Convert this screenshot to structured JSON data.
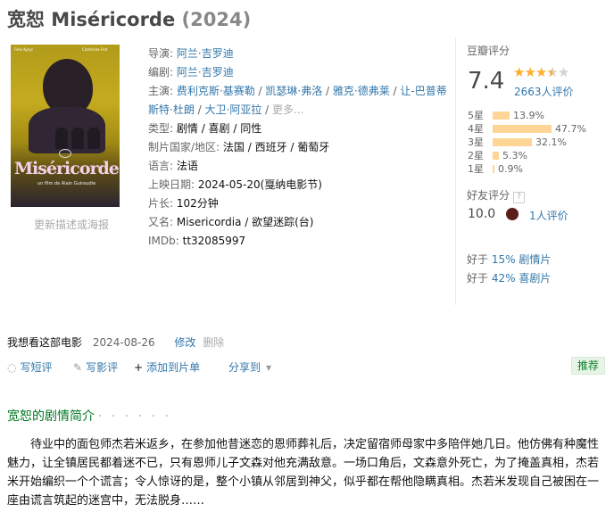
{
  "title": {
    "main": "宽恕 Miséricorde",
    "year": "(2024)"
  },
  "poster": {
    "big_title": "Miséricorde",
    "subtitle": "un film de Alain Guiraudie",
    "actor_left": "Félix Kysyl",
    "actor_right": "Catherine Frot",
    "link_text": "更新描述或海报"
  },
  "info": {
    "director_label": "导演:",
    "director": "阿兰·吉罗迪",
    "writer_label": "编剧:",
    "writer": "阿兰·吉罗迪",
    "cast_label": "主演:",
    "cast": [
      "费利克斯·基赛勒",
      "凯瑟琳·弗洛",
      "雅克·德弗莱",
      "让-巴普蒂斯特·杜朗",
      "大卫·阿亚拉"
    ],
    "cast_more": "更多...",
    "genre_label": "类型:",
    "genre": "剧情 / 喜剧 / 同性",
    "country_label": "制片国家/地区:",
    "country": "法国 / 西班牙 / 葡萄牙",
    "language_label": "语言:",
    "language": "法语",
    "release_label": "上映日期:",
    "release": "2024-05-20(戛纳电影节)",
    "runtime_label": "片长:",
    "runtime": "102分钟",
    "aka_label": "又名:",
    "aka": "Misericordia / 欲望迷踪(台)",
    "imdb_label": "IMDb:",
    "imdb": "tt32085997"
  },
  "rating": {
    "label": "豆瓣评分",
    "score": "7.4",
    "stars": 3.5,
    "votes": "2663人评价",
    "distribution": [
      {
        "label": "5星",
        "pct": "13.9%",
        "value": 13.9
      },
      {
        "label": "4星",
        "pct": "47.7%",
        "value": 47.7
      },
      {
        "label": "3星",
        "pct": "32.1%",
        "value": 32.1
      },
      {
        "label": "2星",
        "pct": "5.3%",
        "value": 5.3
      },
      {
        "label": "1星",
        "pct": "0.9%",
        "value": 0.9
      }
    ],
    "friend_label": "好友评分",
    "friend_help": "?",
    "friend_score": "10.0",
    "friend_count": "1人评价",
    "better": [
      {
        "prefix": "好于",
        "pct": "15%",
        "genre": "剧情片"
      },
      {
        "prefix": "好于",
        "pct": "42%",
        "genre": "喜剧片"
      }
    ]
  },
  "status": {
    "text": "我想看这部电影",
    "date": "2024-08-26",
    "edit": "修改",
    "delete": "删除"
  },
  "actions": {
    "comment": "写短评",
    "review": "写影评",
    "add_list": "添加到片单",
    "share": "分享到",
    "recommend": "推荐"
  },
  "synopsis": {
    "title": "宽恕的剧情简介",
    "dots": "· · · · · ·",
    "text": "待业中的面包师杰若米返乡，在参加他昔迷恋的恩师葬礼后，决定留宿师母家中多陪伴她几日。他仿佛有种魔性魅力，让全镇居民都着迷不已，只有恩师儿子文森对他充满敌意。一场口角后，文森意外死亡，为了掩盖真相，杰若米开始编织一个个谎言；令人惊讶的是，整个小镇从邻居到神父，似乎都在帮他隐瞒真相。杰若米发现自己被困在一座由谎言筑起的迷宫中，无法脱身……"
  },
  "colors": {
    "link": "#3377aa",
    "star": "#ffac2d",
    "bar": "#ffd596",
    "green": "#007722"
  }
}
